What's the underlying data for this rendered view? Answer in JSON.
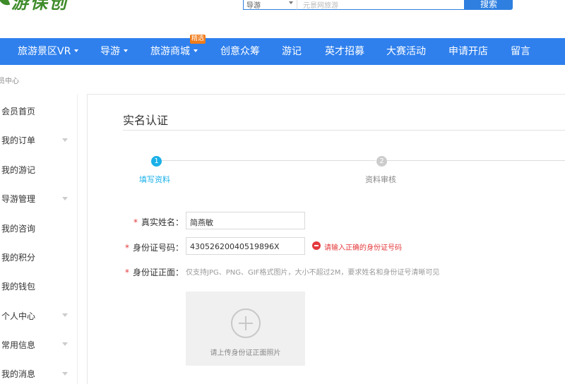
{
  "header": {
    "logo_text": "游保创",
    "search": {
      "category": "导游",
      "placeholder": "元景网旅游",
      "button_label": "搜索"
    }
  },
  "nav": {
    "items": [
      {
        "label": "旅游景区VR",
        "dropdown": true
      },
      {
        "label": "导游",
        "dropdown": true
      },
      {
        "label": "旅游商城",
        "dropdown": true,
        "badge": "精选"
      },
      {
        "label": "创意众筹",
        "dropdown": false
      },
      {
        "label": "游记",
        "dropdown": false
      },
      {
        "label": "英才招募",
        "dropdown": false
      },
      {
        "label": "大赛活动",
        "dropdown": false
      },
      {
        "label": "申请开店",
        "dropdown": false
      },
      {
        "label": "留言",
        "dropdown": false
      }
    ]
  },
  "breadcrumb": "员中心",
  "sidebar": {
    "items": [
      {
        "label": "会员首页",
        "expandable": false
      },
      {
        "label": "我的订单",
        "expandable": true
      },
      {
        "label": "我的游记",
        "expandable": false
      },
      {
        "label": "导游管理",
        "expandable": true
      },
      {
        "label": "我的咨询",
        "expandable": false
      },
      {
        "label": "我的积分",
        "expandable": false
      },
      {
        "label": "我的钱包",
        "expandable": false
      },
      {
        "label": "个人中心",
        "expandable": true
      },
      {
        "label": "常用信息",
        "expandable": true
      },
      {
        "label": "我的消息",
        "expandable": true
      }
    ]
  },
  "main": {
    "title": "实名认证",
    "steps": [
      {
        "number": "1",
        "label": "填写资料",
        "active": true
      },
      {
        "number": "2",
        "label": "资料审核",
        "active": false
      }
    ],
    "form": {
      "name": {
        "label": "真实姓名：",
        "value": "简燕敏"
      },
      "id_number": {
        "label": "身份证号码：",
        "value": "430526200405198​96X",
        "error": "请输入正确的身份证号码"
      },
      "id_front": {
        "label": "身份证正面：",
        "hint": "仅支持JPG、PNG、GIF格式图片，大小不超过2M，要求姓名和身份证号清晰可见",
        "upload_text": "请上传身份证正面照片"
      }
    }
  },
  "colors": {
    "nav_bg": "#2f80ed",
    "accent": "#2f7fe0",
    "step_active": "#1ab0e8",
    "step_inactive": "#cccccc",
    "error": "#e4393c",
    "logo_green": "#3e8b2a",
    "badge": "#f07b18"
  }
}
